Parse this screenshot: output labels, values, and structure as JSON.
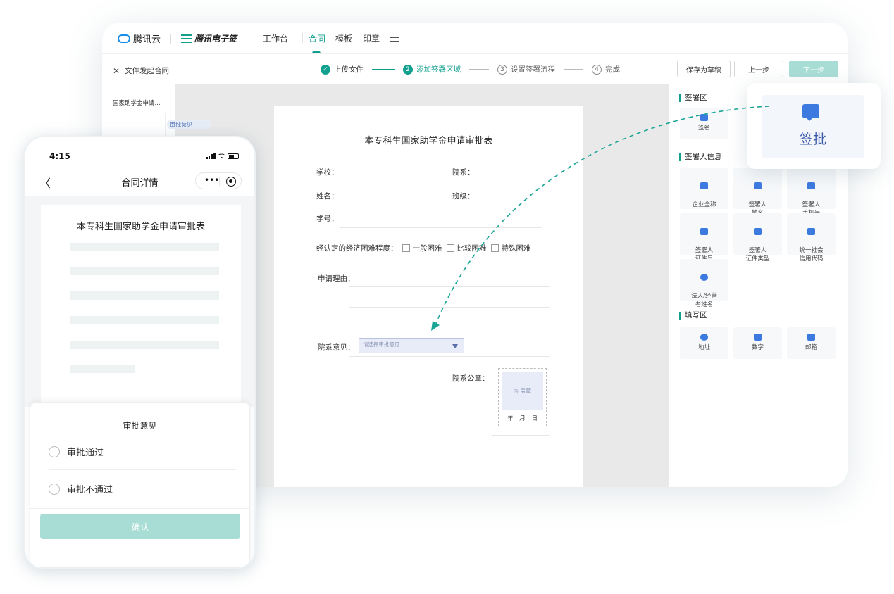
{
  "brand": {
    "cloud_name": "腾讯云",
    "product_name": "腾讯电子签"
  },
  "topnav": {
    "items": [
      "工作台",
      "合同",
      "模板",
      "印章"
    ]
  },
  "subbar": {
    "close": "✕",
    "title": "文件发起合同",
    "steps": [
      {
        "num": "✓",
        "label": "上传文件",
        "state": "done"
      },
      {
        "num": "2",
        "label": "添加签署区域",
        "state": "active"
      },
      {
        "num": "3",
        "label": "设置签署流程",
        "state": "todo"
      },
      {
        "num": "4",
        "label": "完成",
        "state": "todo"
      }
    ],
    "save_draft": "保存为草稿",
    "prev": "上一步",
    "next": "下一步"
  },
  "left_strip": {
    "doc_title": "国家助学金申请...",
    "tag": "审批意见"
  },
  "paper": {
    "title": "本专科生国家助学金申请审批表",
    "school": "学校：",
    "department": "院系：",
    "name": "姓名：",
    "class": "班级：",
    "student_id": "学号：",
    "difficulty": "经认定的经济困难程度：",
    "opt1": "一般困难",
    "opt2": "比较困难",
    "opt3": "特殊困难",
    "reason": "申请理由：",
    "dept_opinion": "院系意见：",
    "select_placeholder": "请选择审批意见",
    "dept_seal": "院系公章：",
    "seal_text": "◎ 盖章",
    "seal_date": "年 月 日"
  },
  "right_panel": {
    "sign_area": "签署区",
    "sign_tiles": [
      "签名"
    ],
    "signer_info": "签署人信息",
    "signer_tiles": [
      "企业全称",
      "签署人\n姓名",
      "签署人\n手机号",
      "签署人\n证件号",
      "签署人\n证件类型",
      "统一社会\n信用代码",
      "法人/经营\n者姓名"
    ],
    "fill_area": "填写区",
    "fill_tiles": [
      "地址",
      "数字",
      "邮箱"
    ]
  },
  "float_card": {
    "label": "签批"
  },
  "phone": {
    "time": "4:15",
    "wifi": "ᯤ",
    "back": "〈",
    "title": "合同详情",
    "capsule_dots": "•••",
    "doc_title": "本专科生国家助学金申请审批表",
    "sheet_title": "审批意见",
    "option_pass": "审批通过",
    "option_fail": "审批不通过",
    "confirm": "确认"
  },
  "colors": {
    "accent": "#11a08e",
    "blue": "#3d7ae0",
    "next_disabled": "#a8ddd5"
  }
}
